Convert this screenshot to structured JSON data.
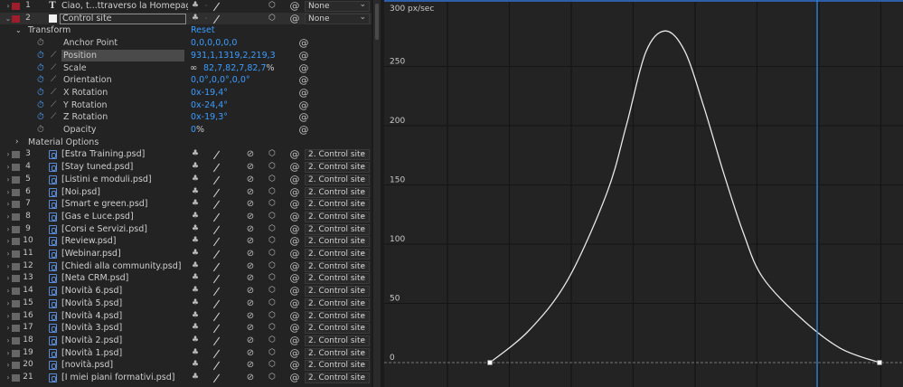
{
  "layers_top": [
    {
      "num": "1",
      "type": "T",
      "name": "Ciao, t...ttraverso la Homepage.",
      "parent": "None",
      "color": "#9e1d2b"
    },
    {
      "num": "2",
      "type": "solid",
      "name": "Control site",
      "parent": "None",
      "color": "#9e1d2b",
      "selected": true
    }
  ],
  "transform": {
    "label": "Transform",
    "reset": "Reset",
    "properties": [
      {
        "name": "Anchor Point",
        "value": "0,0,0,0,0,0",
        "animated": false
      },
      {
        "name": "Position",
        "value": "931,1,1319,2,219,3",
        "animated": true,
        "selected": true
      },
      {
        "name": "Scale",
        "value": "82,7,82,7,82,7",
        "suffix": "%",
        "animated": true,
        "linked": true
      },
      {
        "name": "Orientation",
        "value": "0,0°,0,0°,0,0°",
        "animated": true
      },
      {
        "name": "X Rotation",
        "value": "0x-19,4°",
        "animated": true
      },
      {
        "name": "Y Rotation",
        "value": "0x-24,4°",
        "animated": true
      },
      {
        "name": "Z Rotation",
        "value": "0x-19,3°",
        "animated": true
      },
      {
        "name": "Opacity",
        "value": "0",
        "suffix": "%",
        "animated": false
      }
    ]
  },
  "material_options": "Material Options",
  "layers": [
    {
      "num": "3",
      "name": "[Estra Training.psd]",
      "parent": "2. Control site"
    },
    {
      "num": "4",
      "name": "[Stay tuned.psd]",
      "parent": "2. Control site"
    },
    {
      "num": "5",
      "name": "[Listini e moduli.psd]",
      "parent": "2. Control site"
    },
    {
      "num": "6",
      "name": "[Noi.psd]",
      "parent": "2. Control site"
    },
    {
      "num": "7",
      "name": "[Smart e green.psd]",
      "parent": "2. Control site"
    },
    {
      "num": "8",
      "name": "[Gas e Luce.psd]",
      "parent": "2. Control site"
    },
    {
      "num": "9",
      "name": "[Corsi e Servizi.psd]",
      "parent": "2. Control site"
    },
    {
      "num": "10",
      "name": "[Review.psd]",
      "parent": "2. Control site"
    },
    {
      "num": "11",
      "name": "[Webinar.psd]",
      "parent": "2. Control site"
    },
    {
      "num": "12",
      "name": "[Chiedi alla community.psd]",
      "parent": "2. Control site"
    },
    {
      "num": "13",
      "name": "[Neta CRM.psd]",
      "parent": "2. Control site"
    },
    {
      "num": "14",
      "name": "[Novità 6.psd]",
      "parent": "2. Control site"
    },
    {
      "num": "15",
      "name": "[Novità 5.psd]",
      "parent": "2. Control site"
    },
    {
      "num": "16",
      "name": "[Novità 4.psd]",
      "parent": "2. Control site"
    },
    {
      "num": "17",
      "name": "[Novità 3.psd]",
      "parent": "2. Control site"
    },
    {
      "num": "18",
      "name": "[Novità 2.psd]",
      "parent": "2. Control site"
    },
    {
      "num": "19",
      "name": "[Novità 1.psd]",
      "parent": "2. Control site"
    },
    {
      "num": "20",
      "name": "[novità.psd]",
      "parent": "2. Control site"
    },
    {
      "num": "21",
      "name": "[I miei piani formativi.psd]",
      "parent": "2. Control site"
    }
  ],
  "colors": {
    "accent_blue": "#3b9cff",
    "label_red": "#9e1d2b",
    "label_gray": "#666666",
    "playhead": "#2d7fd4"
  },
  "chart_data": {
    "type": "line",
    "title": "",
    "ylabel": "",
    "y_unit_label": "300 px/sec",
    "y_ticks": [
      "0",
      "50",
      "100",
      "150",
      "200",
      "250"
    ],
    "ylim": [
      0,
      300
    ],
    "x_range": [
      0,
      1
    ],
    "series": [
      {
        "x": [
          0.0,
          0.1,
          0.2,
          0.3,
          0.35,
          0.4,
          0.45,
          0.5,
          0.55,
          0.6,
          0.65,
          0.7,
          0.8,
          0.9,
          1.0
        ],
        "y": [
          0,
          27,
          70,
          143,
          200,
          262,
          280,
          263,
          215,
          160,
          110,
          72,
          37,
          12,
          0
        ]
      }
    ],
    "keyframes_x": [
      0.0,
      1.0
    ],
    "playhead_x": 0.84
  }
}
